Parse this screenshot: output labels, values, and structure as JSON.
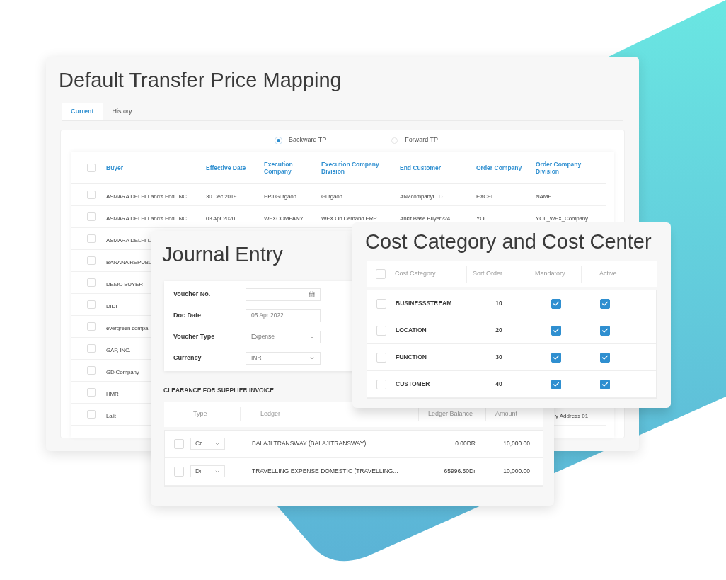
{
  "transfer_price_mapping": {
    "title": "Default Transfer Price Mapping",
    "tabs": [
      {
        "label": "Current",
        "selected": true
      },
      {
        "label": "History",
        "selected": false
      }
    ],
    "options": [
      {
        "label": "Backward TP",
        "selected": true
      },
      {
        "label": "Forward TP",
        "selected": false
      }
    ],
    "table": {
      "all_checked": false,
      "columns": [
        "Buyer",
        "Effective Date",
        "Execution Company",
        "Execution Company Division",
        "End Customer",
        "Order Company",
        "Order Company Division"
      ],
      "rows": [
        {
          "checked": false,
          "cells": [
            "ASMARA DELHI Land's End, INC",
            "30 Dec 2019",
            "PPJ Gurgaon",
            "Gurgaon",
            "ANZcompanyLTD",
            "EXCEL",
            "NAME"
          ]
        },
        {
          "checked": false,
          "cells": [
            "ASMARA DELHI Land's End, INC",
            "03 Apr 2020",
            "WFXCOMPANY",
            "WFX On Demand ERP",
            "Ankit Base Buyer224",
            "YOL",
            "YOL_WFX_Company"
          ]
        },
        {
          "checked": false,
          "cells": [
            "ASMARA DELHI L"
          ]
        },
        {
          "checked": false,
          "cells": [
            "BANANA REPUBL"
          ]
        },
        {
          "checked": false,
          "cells": [
            "DEMO BUYER"
          ]
        },
        {
          "checked": false,
          "cells": [
            "DIDI"
          ]
        },
        {
          "checked": false,
          "cells": [
            "evergreen compa"
          ]
        },
        {
          "checked": false,
          "cells": [
            "GAP, INC."
          ]
        },
        {
          "checked": false,
          "cells": [
            "GD Company"
          ]
        },
        {
          "checked": false,
          "cells": [
            "HMR"
          ]
        },
        {
          "checked": false,
          "cells": [
            "Lalit"
          ],
          "last_cell": "y Address 01"
        }
      ]
    }
  },
  "journal_entry": {
    "title": "Journal Entry",
    "fields": [
      {
        "label": "Voucher No.",
        "kind": "date"
      },
      {
        "label": "Doc Date",
        "kind": "text",
        "value": "05 Apr 2022"
      },
      {
        "label": "Voucher Type",
        "kind": "select",
        "value": "Expense"
      },
      {
        "label": "Currency",
        "kind": "select",
        "value": "INR"
      }
    ],
    "section_title": "CLEARANCE FOR SUPPLIER INVOICE",
    "table": {
      "columns": [
        "Type",
        "Ledger",
        "Ledger Balance",
        "Amount"
      ],
      "rows": [
        {
          "checked": false,
          "type": "Cr",
          "ledger": "BALAJI TRANSWAY (BALAJITRANSWAY)",
          "balance": "0.00DR",
          "amount": "10,000.00"
        },
        {
          "checked": false,
          "type": "Dr",
          "ledger": "TRAVELLING EXPENSE DOMESTIC (TRAVELLING...",
          "balance": "65996.50Dr",
          "amount": "10,000.00"
        }
      ]
    }
  },
  "cost_category": {
    "title": "Cost Category and Cost Center",
    "all_checked": false,
    "columns": [
      "Cost Category",
      "Sort Order",
      "Mandatory",
      "Active"
    ],
    "rows": [
      {
        "checked": false,
        "name": "BUSINESSSTREAM",
        "sort_order": "10",
        "mandatory": true,
        "active": true
      },
      {
        "checked": false,
        "name": "LOCATION",
        "sort_order": "20",
        "mandatory": true,
        "active": true
      },
      {
        "checked": false,
        "name": "FUNCTION",
        "sort_order": "30",
        "mandatory": true,
        "active": true
      },
      {
        "checked": false,
        "name": "CUSTOMER",
        "sort_order": "40",
        "mandatory": true,
        "active": true
      }
    ]
  }
}
